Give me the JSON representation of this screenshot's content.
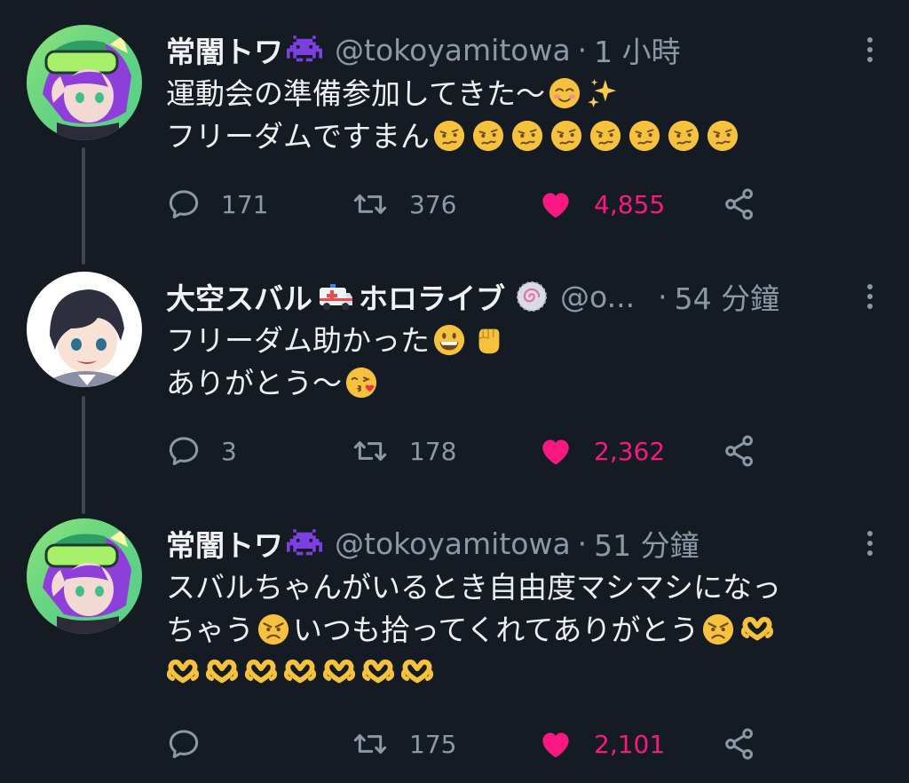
{
  "thread": [
    {
      "name": "常闇トワ",
      "handle": "@tokoyamitowa",
      "sep": "·",
      "time": "1 小時",
      "lines": [
        "運動会の準備参加してきた〜",
        "フリーダムですまん"
      ],
      "replies": "171",
      "retweets": "376",
      "likes": "4,855",
      "avatar_icon": "towa-avatar",
      "name_badge_icon": "purple-alien-icon"
    },
    {
      "name": "大空スバル",
      "name_suffix": "ホロライブ",
      "handle": "@o...",
      "sep": "·",
      "time": "54 分鐘",
      "lines": [
        "フリーダム助かった",
        "ありがとう〜"
      ],
      "replies": "3",
      "retweets": "178",
      "likes": "2,362",
      "avatar_icon": "subaru-avatar",
      "name_badge_icon": "ambulance-icon",
      "verified_badge_icon": "hololive-badge-icon"
    },
    {
      "name": "常闇トワ",
      "handle": "@tokoyamitowa",
      "sep": "·",
      "time": "51 分鐘",
      "lines": [
        "スバルちゃんがいるとき自由度マシマシになっ",
        "ちゃう",
        "いつも拾ってくれてありがとう"
      ],
      "replies": "",
      "retweets": "175",
      "likes": "2,101",
      "avatar_icon": "towa-avatar",
      "name_badge_icon": "purple-alien-icon"
    }
  ],
  "colors": {
    "background": "#151b23",
    "name": "#f0f2f3",
    "muted": "#8b98a5",
    "like": "#f91880",
    "thread_line": "#3d4650"
  }
}
